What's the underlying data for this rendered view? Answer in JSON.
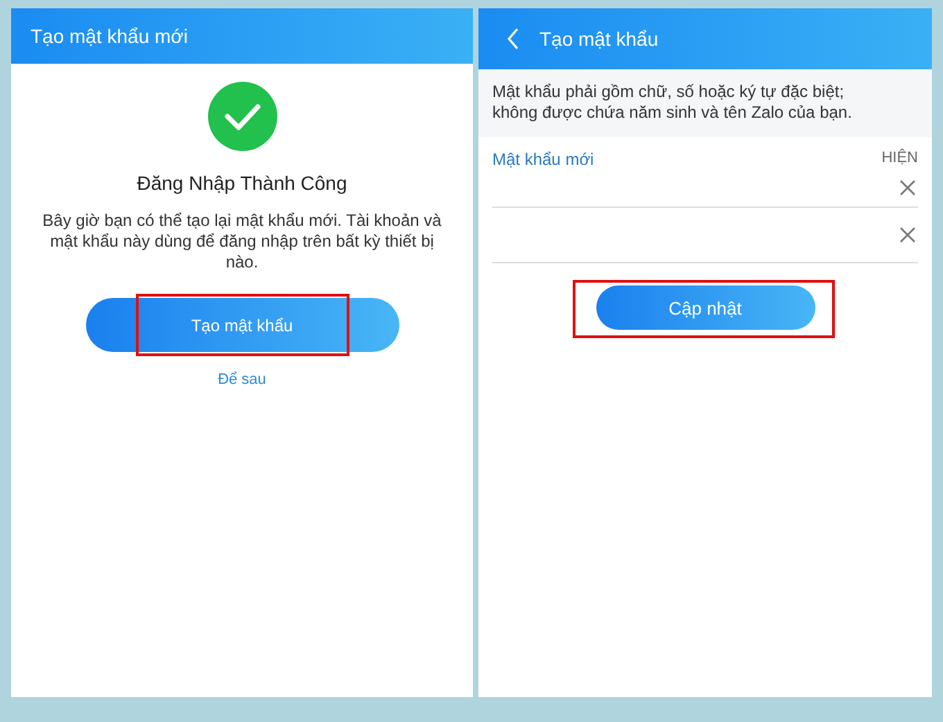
{
  "screens": [
    {
      "kind": "success",
      "header": {
        "title": "Tạo mật khẩu mới",
        "back": false
      },
      "heading": "Đăng Nhập Thành Công",
      "message": "Bây giờ bạn có thể tạo lại mật khẩu mới. Tài khoản và mật khẩu này dùng để đăng nhập trên bất kỳ thiết bị nào.",
      "button": {
        "label": "Tạo mật khẩu",
        "highlighted": true
      },
      "link": "Để sau"
    },
    {
      "kind": "form",
      "header": {
        "title": "Tạo mật khẩu",
        "back": true
      },
      "note": "Mật khẩu phải gồm chữ, số hoặc ký tự đặc biệt; không được chứa năm sinh và tên Zalo của bạn.",
      "field_label": "Mật khẩu mới",
      "toggle": "HIỆN",
      "fields": [
        {
          "clearable": true
        },
        {
          "clearable": true
        }
      ],
      "button": {
        "label": "Cập nhật",
        "highlighted": true
      }
    }
  ]
}
